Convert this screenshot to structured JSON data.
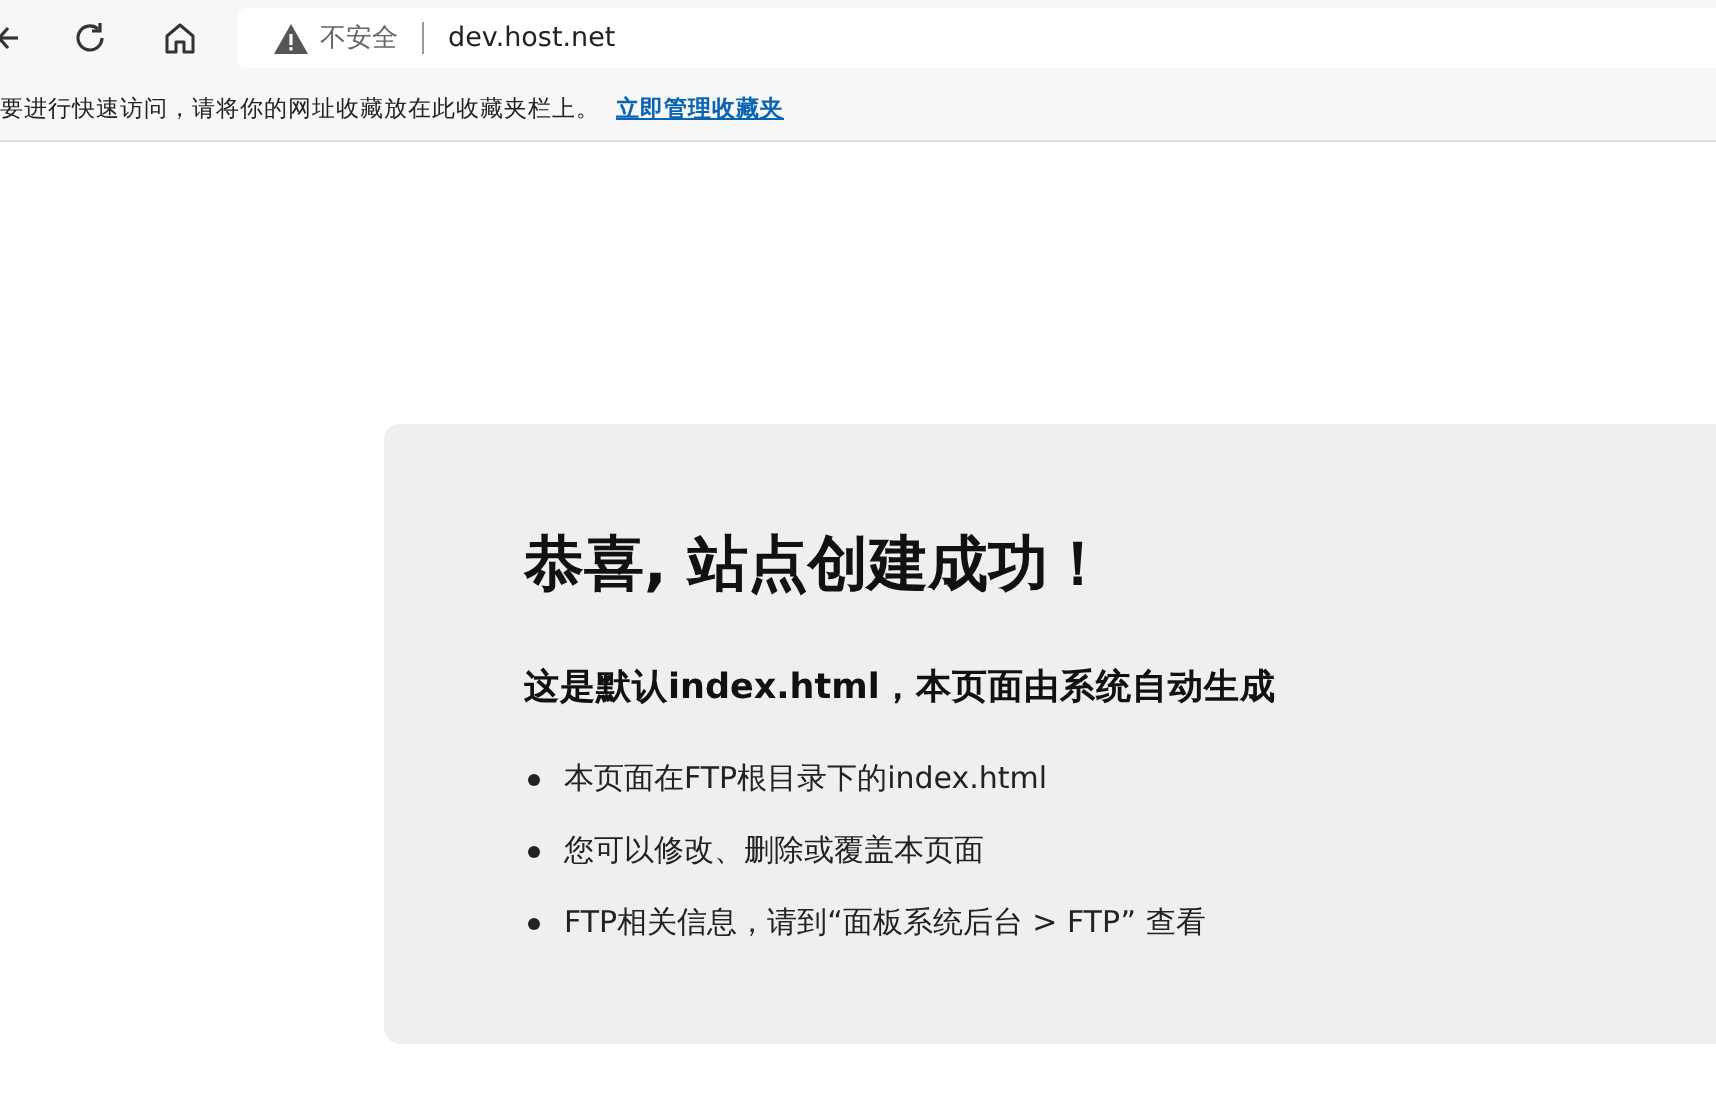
{
  "toolbar": {
    "security_label": "不安全",
    "url": "dev.host.net"
  },
  "bookmarks_bar": {
    "message": "要进行快速访问，请将你的网址收藏放在此收藏夹栏上。",
    "link": "立即管理收藏夹"
  },
  "page": {
    "title": "恭喜, 站点创建成功！",
    "subtitle": "这是默认index.html，本页面由系统自动生成",
    "items": [
      "本页面在FTP根目录下的index.html",
      "您可以修改、删除或覆盖本页面",
      "FTP相关信息，请到“面板系统后台 > FTP” 查看"
    ]
  }
}
